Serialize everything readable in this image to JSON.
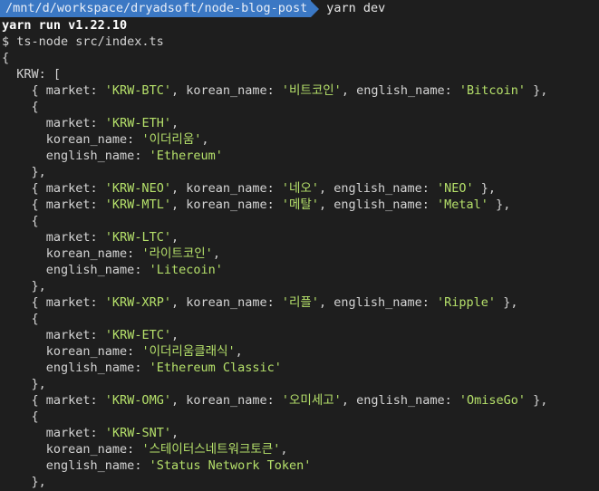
{
  "prompt": {
    "path": "/mnt/d/workspace/dryadsoft/node-blog-post",
    "command": "yarn dev"
  },
  "output": {
    "yarn_header": "yarn run v1.22.10",
    "run_cmd": "$ ts-node src/index.ts",
    "open_brace": "{",
    "krw_key": "KRW: [",
    "lines": [
      {
        "indent": "    ",
        "parts": [
          [
            "p",
            "{ market: "
          ],
          [
            "s",
            "'KRW-BTC'"
          ],
          [
            "p",
            ", korean_name: "
          ],
          [
            "s",
            "'비트코인'"
          ],
          [
            "p",
            ", english_name: "
          ],
          [
            "s",
            "'Bitcoin'"
          ],
          [
            "p",
            " },"
          ]
        ]
      },
      {
        "indent": "    ",
        "parts": [
          [
            "p",
            "{"
          ]
        ]
      },
      {
        "indent": "      ",
        "parts": [
          [
            "p",
            "market: "
          ],
          [
            "s",
            "'KRW-ETH'"
          ],
          [
            "p",
            ","
          ]
        ]
      },
      {
        "indent": "      ",
        "parts": [
          [
            "p",
            "korean_name: "
          ],
          [
            "s",
            "'이더리움'"
          ],
          [
            "p",
            ","
          ]
        ]
      },
      {
        "indent": "      ",
        "parts": [
          [
            "p",
            "english_name: "
          ],
          [
            "s",
            "'Ethereum'"
          ]
        ]
      },
      {
        "indent": "    ",
        "parts": [
          [
            "p",
            "},"
          ]
        ]
      },
      {
        "indent": "    ",
        "parts": [
          [
            "p",
            "{ market: "
          ],
          [
            "s",
            "'KRW-NEO'"
          ],
          [
            "p",
            ", korean_name: "
          ],
          [
            "s",
            "'네오'"
          ],
          [
            "p",
            ", english_name: "
          ],
          [
            "s",
            "'NEO'"
          ],
          [
            "p",
            " },"
          ]
        ]
      },
      {
        "indent": "    ",
        "parts": [
          [
            "p",
            "{ market: "
          ],
          [
            "s",
            "'KRW-MTL'"
          ],
          [
            "p",
            ", korean_name: "
          ],
          [
            "s",
            "'메탈'"
          ],
          [
            "p",
            ", english_name: "
          ],
          [
            "s",
            "'Metal'"
          ],
          [
            "p",
            " },"
          ]
        ]
      },
      {
        "indent": "    ",
        "parts": [
          [
            "p",
            "{"
          ]
        ]
      },
      {
        "indent": "      ",
        "parts": [
          [
            "p",
            "market: "
          ],
          [
            "s",
            "'KRW-LTC'"
          ],
          [
            "p",
            ","
          ]
        ]
      },
      {
        "indent": "      ",
        "parts": [
          [
            "p",
            "korean_name: "
          ],
          [
            "s",
            "'라이트코인'"
          ],
          [
            "p",
            ","
          ]
        ]
      },
      {
        "indent": "      ",
        "parts": [
          [
            "p",
            "english_name: "
          ],
          [
            "s",
            "'Litecoin'"
          ]
        ]
      },
      {
        "indent": "    ",
        "parts": [
          [
            "p",
            "},"
          ]
        ]
      },
      {
        "indent": "    ",
        "parts": [
          [
            "p",
            "{ market: "
          ],
          [
            "s",
            "'KRW-XRP'"
          ],
          [
            "p",
            ", korean_name: "
          ],
          [
            "s",
            "'리플'"
          ],
          [
            "p",
            ", english_name: "
          ],
          [
            "s",
            "'Ripple'"
          ],
          [
            "p",
            " },"
          ]
        ]
      },
      {
        "indent": "    ",
        "parts": [
          [
            "p",
            "{"
          ]
        ]
      },
      {
        "indent": "      ",
        "parts": [
          [
            "p",
            "market: "
          ],
          [
            "s",
            "'KRW-ETC'"
          ],
          [
            "p",
            ","
          ]
        ]
      },
      {
        "indent": "      ",
        "parts": [
          [
            "p",
            "korean_name: "
          ],
          [
            "s",
            "'이더리움클래식'"
          ],
          [
            "p",
            ","
          ]
        ]
      },
      {
        "indent": "      ",
        "parts": [
          [
            "p",
            "english_name: "
          ],
          [
            "s",
            "'Ethereum Classic'"
          ]
        ]
      },
      {
        "indent": "    ",
        "parts": [
          [
            "p",
            "},"
          ]
        ]
      },
      {
        "indent": "    ",
        "parts": [
          [
            "p",
            "{ market: "
          ],
          [
            "s",
            "'KRW-OMG'"
          ],
          [
            "p",
            ", korean_name: "
          ],
          [
            "s",
            "'오미세고'"
          ],
          [
            "p",
            ", english_name: "
          ],
          [
            "s",
            "'OmiseGo'"
          ],
          [
            "p",
            " },"
          ]
        ]
      },
      {
        "indent": "    ",
        "parts": [
          [
            "p",
            "{"
          ]
        ]
      },
      {
        "indent": "      ",
        "parts": [
          [
            "p",
            "market: "
          ],
          [
            "s",
            "'KRW-SNT'"
          ],
          [
            "p",
            ","
          ]
        ]
      },
      {
        "indent": "      ",
        "parts": [
          [
            "p",
            "korean_name: "
          ],
          [
            "s",
            "'스테이터스네트워크토큰'"
          ],
          [
            "p",
            ","
          ]
        ]
      },
      {
        "indent": "      ",
        "parts": [
          [
            "p",
            "english_name: "
          ],
          [
            "s",
            "'Status Network Token'"
          ]
        ]
      },
      {
        "indent": "    ",
        "parts": [
          [
            "p",
            "},"
          ]
        ]
      }
    ]
  },
  "colors": {
    "background": "#1e1e1e",
    "path_bg": "#3b78c4",
    "string": "#b5e06a",
    "text": "#d4d4d4"
  }
}
